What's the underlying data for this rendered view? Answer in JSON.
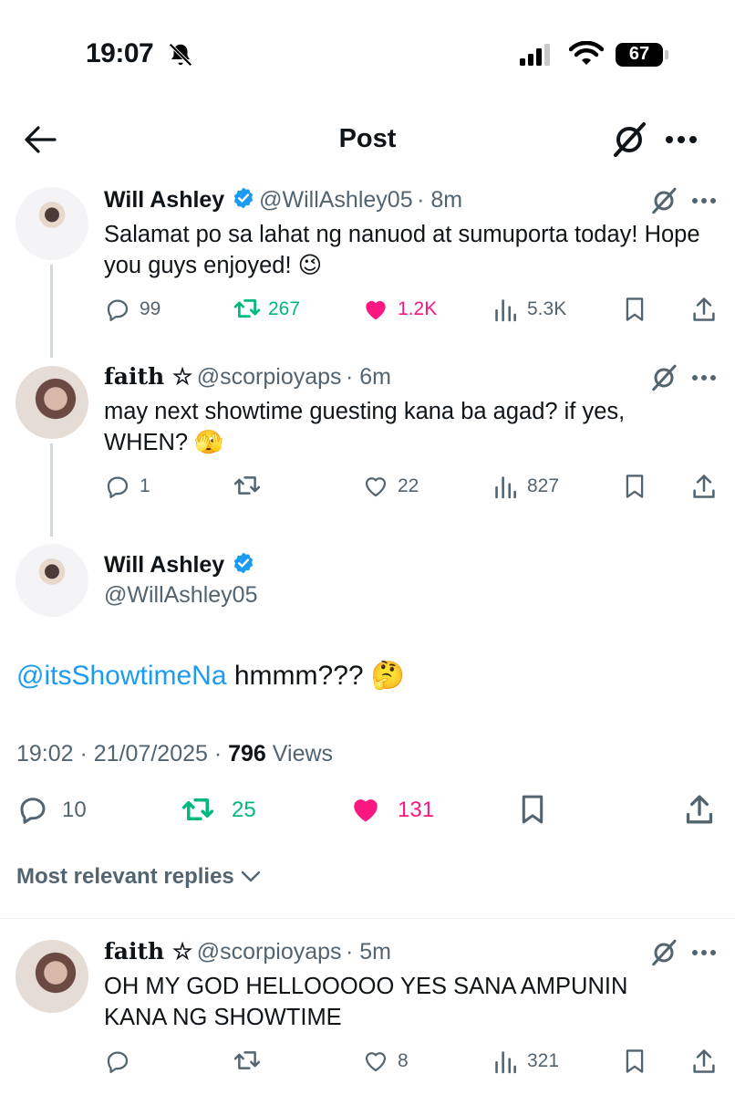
{
  "status_bar": {
    "time": "19:07",
    "battery": "67"
  },
  "nav": {
    "title": "Post"
  },
  "thread": [
    {
      "name": "Will Ashley",
      "handle": "@WillAshley05",
      "time": "· 8m",
      "text": "Salamat po sa lahat ng nanuod at sumuporta today! Hope you guys enjoyed! 😉",
      "replies": "99",
      "reposts": "267",
      "likes": "1.2K",
      "views": "5.3K",
      "liked": true,
      "reposted": true
    },
    {
      "name": "faith ☆",
      "handle": "@scorpioyaps",
      "time": "· 6m",
      "text": "may next showtime guesting kana ba agad? if yes, WHEN? 🫣",
      "replies": "1",
      "reposts": "",
      "likes": "22",
      "views": "827",
      "liked": false,
      "reposted": false
    }
  ],
  "main_post": {
    "name": "Will Ashley",
    "handle": "@WillAshley05",
    "mention": "@itsShowtimeNa",
    "text": " hmmm??? 🤔",
    "timestamp": "19:02 · 21/07/2025 · ",
    "views_count": "796",
    "views_label": " Views",
    "replies": "10",
    "reposts": "25",
    "likes": "131"
  },
  "sort": {
    "label": "Most relevant replies"
  },
  "reply": {
    "name": "faith ☆",
    "handle": "@scorpioyaps",
    "time": "· 5m",
    "text": "OH MY GOD HELLOOOOO YES SANA AMPUNIN KANA NG SHOWTIME",
    "replies": "",
    "reposts": "",
    "likes": "8",
    "views": "321"
  },
  "colors": {
    "accent": "#1d9bf0",
    "like": "#f91880",
    "repost": "#00ba7c",
    "muted": "#536471",
    "text": "#0f1419"
  }
}
